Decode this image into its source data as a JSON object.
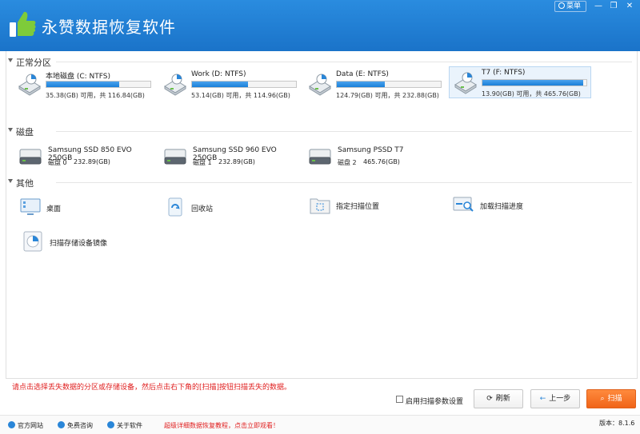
{
  "app": {
    "title": "永赞数据恢复软件",
    "menu_label": "菜单"
  },
  "window_buttons": {
    "minimize": "—",
    "restore": "❐",
    "close": "✕"
  },
  "sections": {
    "partitions": "正常分区",
    "disks": "磁盘",
    "others": "其他"
  },
  "partitions": [
    {
      "name": "本地磁盘 (C: NTFS)",
      "capacity": "35.38(GB) 可用，共 116.84(GB)",
      "used_fraction": 0.7,
      "selected": false
    },
    {
      "name": "Work (D: NTFS)",
      "capacity": "53.14(GB) 可用，共 114.96(GB)",
      "used_fraction": 0.54,
      "selected": false
    },
    {
      "name": "Data (E: NTFS)",
      "capacity": "124.79(GB) 可用，共 232.88(GB)",
      "used_fraction": 0.46,
      "selected": false
    },
    {
      "name": "T7 (F: NTFS)",
      "capacity": "13.90(GB) 可用，共 465.76(GB)",
      "used_fraction": 0.97,
      "selected": true
    }
  ],
  "disks": [
    {
      "name": "Samsung SSD 850 EVO 250GB",
      "index": "磁盘 0",
      "size": "232.89(GB)"
    },
    {
      "name": "Samsung SSD 960 EVO 250GB",
      "index": "磁盘 1",
      "size": "232.89(GB)"
    },
    {
      "name": "Samsung PSSD T7",
      "index": "磁盘 2",
      "size": "465.76(GB)"
    }
  ],
  "others": [
    {
      "label": "桌面",
      "icon": "desktop-icon"
    },
    {
      "label": "回收站",
      "icon": "recycle-bin-icon"
    },
    {
      "label": "指定扫描位置",
      "icon": "folder-scan-icon"
    },
    {
      "label": "加载扫描进度",
      "icon": "load-progress-icon"
    },
    {
      "label": "扫描存储设备镜像",
      "icon": "disk-image-icon"
    }
  ],
  "hint": "请点击选择丢失数据的分区或存储设备，然后点击右下角的[扫描]按钮扫描丢失的数据。",
  "controls": {
    "scan_params_label": "启用扫描参数设置",
    "refresh_label": "刷新",
    "back_label": "上一步",
    "scan_label": "扫描"
  },
  "statusbar": {
    "website": "官方网站",
    "consult": "免费咨询",
    "about": "关于软件",
    "promo": "超级详细数据恢复教程，点击立即观看！",
    "version": "版本：8.1.6"
  },
  "colors": {
    "title_bar": "#1f7fd6",
    "accent": "#f06418",
    "progress": "#1a7fd8"
  }
}
